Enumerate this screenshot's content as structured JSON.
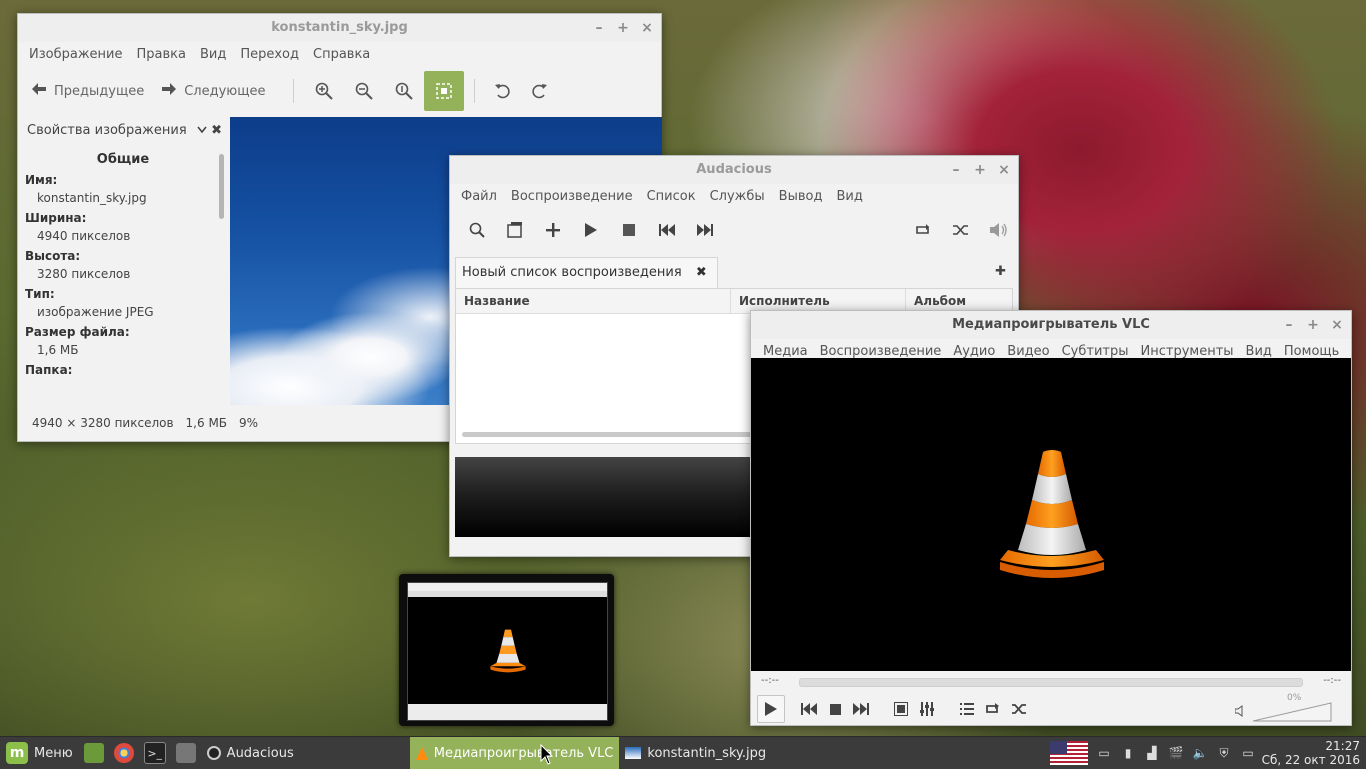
{
  "viewer": {
    "title": "konstantin_sky.jpg",
    "menu": [
      "Изображение",
      "Правка",
      "Вид",
      "Переход",
      "Справка"
    ],
    "prev_label": "Предыдущее",
    "next_label": "Следующее",
    "side_title": "Свойства изображения",
    "section_title": "Общие",
    "props": [
      {
        "label": "Имя:",
        "value": "konstantin_sky.jpg"
      },
      {
        "label": "Ширина:",
        "value": "4940 пикселов"
      },
      {
        "label": "Высота:",
        "value": "3280 пикселов"
      },
      {
        "label": "Тип:",
        "value": "изображение JPEG"
      },
      {
        "label": "Размер файла:",
        "value": "1,6 МБ"
      },
      {
        "label": "Папка:",
        "value": ""
      }
    ],
    "status": {
      "dimensions": "4940 × 3280 пикселов",
      "size": "1,6 МБ",
      "zoom": "9%"
    }
  },
  "audacious": {
    "title": "Audacious",
    "menu": [
      "Файл",
      "Воспроизведение",
      "Список",
      "Службы",
      "Вывод",
      "Вид"
    ],
    "playlist_tab": "Новый список воспроизведения",
    "columns": [
      "Название",
      "Исполнитель",
      "Альбом"
    ]
  },
  "vlc": {
    "title": "Медиапроигрыватель VLC",
    "menu": [
      "Медиа",
      "Воспроизведение",
      "Аудио",
      "Видео",
      "Субтитры",
      "Инструменты",
      "Вид",
      "Помощь"
    ],
    "time_elapsed": "--:--",
    "time_total": "--:--",
    "volume": "0%"
  },
  "taskbar": {
    "menu_label": "Меню",
    "items": [
      {
        "label": "Audacious"
      },
      {
        "label": "Медиапроигрыватель VLC"
      },
      {
        "label": "konstantin_sky.jpg"
      }
    ],
    "clock_time": "21:27",
    "clock_date": "Сб, 22 окт 2016"
  }
}
